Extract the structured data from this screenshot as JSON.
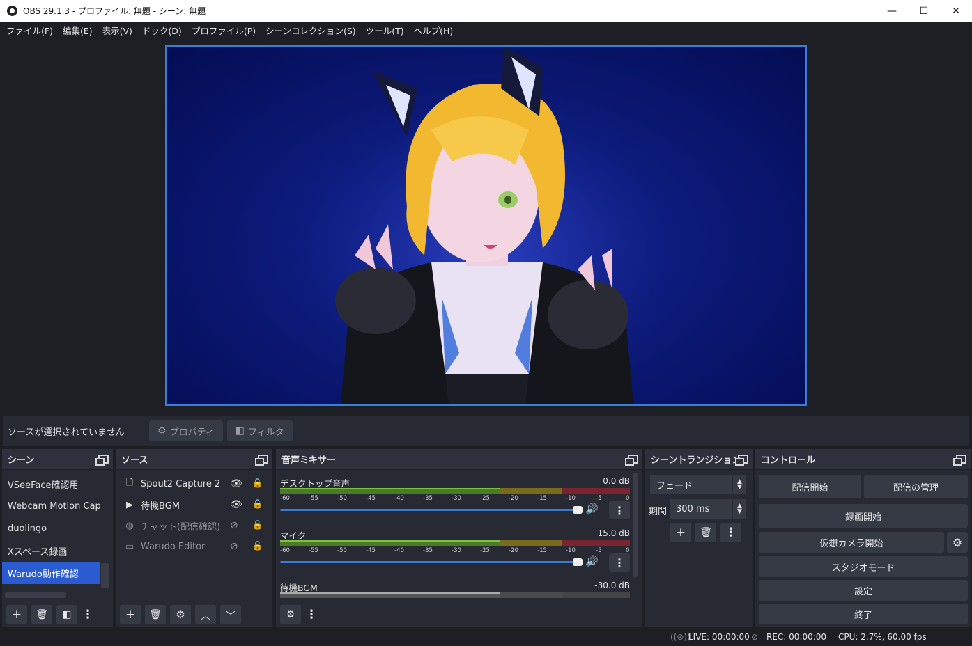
{
  "window": {
    "title": "OBS 29.1.3 - プロファイル: 無題 - シーン: 無題",
    "minimize": "—",
    "maximize": "☐",
    "close": "✕"
  },
  "menu": [
    "ファイル(F)",
    "編集(E)",
    "表示(V)",
    "ドック(D)",
    "プロファイル(P)",
    "シーンコレクション(S)",
    "ツール(T)",
    "ヘルプ(H)"
  ],
  "context_bar": {
    "no_source": "ソースが選択されていません",
    "properties": "プロパティ",
    "filters": "フィルタ"
  },
  "scenes": {
    "title": "シーン",
    "items": [
      "VSeeFace確認用",
      "Webcam Motion Capt",
      "duolingo",
      "Xスペース録画",
      "Warudo動作確認"
    ],
    "selected_index": 4
  },
  "sources": {
    "title": "ソース",
    "items": [
      {
        "name": "Spout2 Capture 2",
        "icon": "document-icon",
        "visible": true
      },
      {
        "name": "待機BGM",
        "icon": "play-icon",
        "visible": true
      },
      {
        "name": "チャット(配信確認)",
        "icon": "globe-icon",
        "visible": false
      },
      {
        "name": "Warudo Editor",
        "icon": "window-icon",
        "visible": false
      }
    ]
  },
  "mixer": {
    "title": "音声ミキサー",
    "ticks": [
      "-60",
      "-55",
      "-50",
      "-45",
      "-40",
      "-35",
      "-30",
      "-25",
      "-20",
      "-15",
      "-10",
      "-5",
      "0"
    ],
    "channels": [
      {
        "name": "デスクトップ音声",
        "db": "0.0 dB",
        "level": 1.0
      },
      {
        "name": "マイク",
        "db": "15.0 dB",
        "level": 1.0
      },
      {
        "name": "待機BGM",
        "db": "-30.0 dB",
        "level": 0.5
      }
    ]
  },
  "transitions": {
    "title": "シーントランジション",
    "selected": "フェード",
    "duration_label": "期間",
    "duration": "300 ms"
  },
  "controls": {
    "title": "コントロール",
    "start_streaming": "配信開始",
    "manage_stream": "配信の管理",
    "start_recording": "録画開始",
    "start_virtual_cam": "仮想カメラ開始",
    "studio_mode": "スタジオモード",
    "settings": "設定",
    "exit": "終了"
  },
  "status": {
    "live": "LIVE: 00:00:00",
    "rec": "REC: 00:00:00",
    "cpu": "CPU: 2.7%, 60.00 fps"
  },
  "colors": {
    "accent": "#2a5bd1",
    "preview_border": "#3a7dd8",
    "panel": "#272a33",
    "background": "#1e1f25"
  }
}
